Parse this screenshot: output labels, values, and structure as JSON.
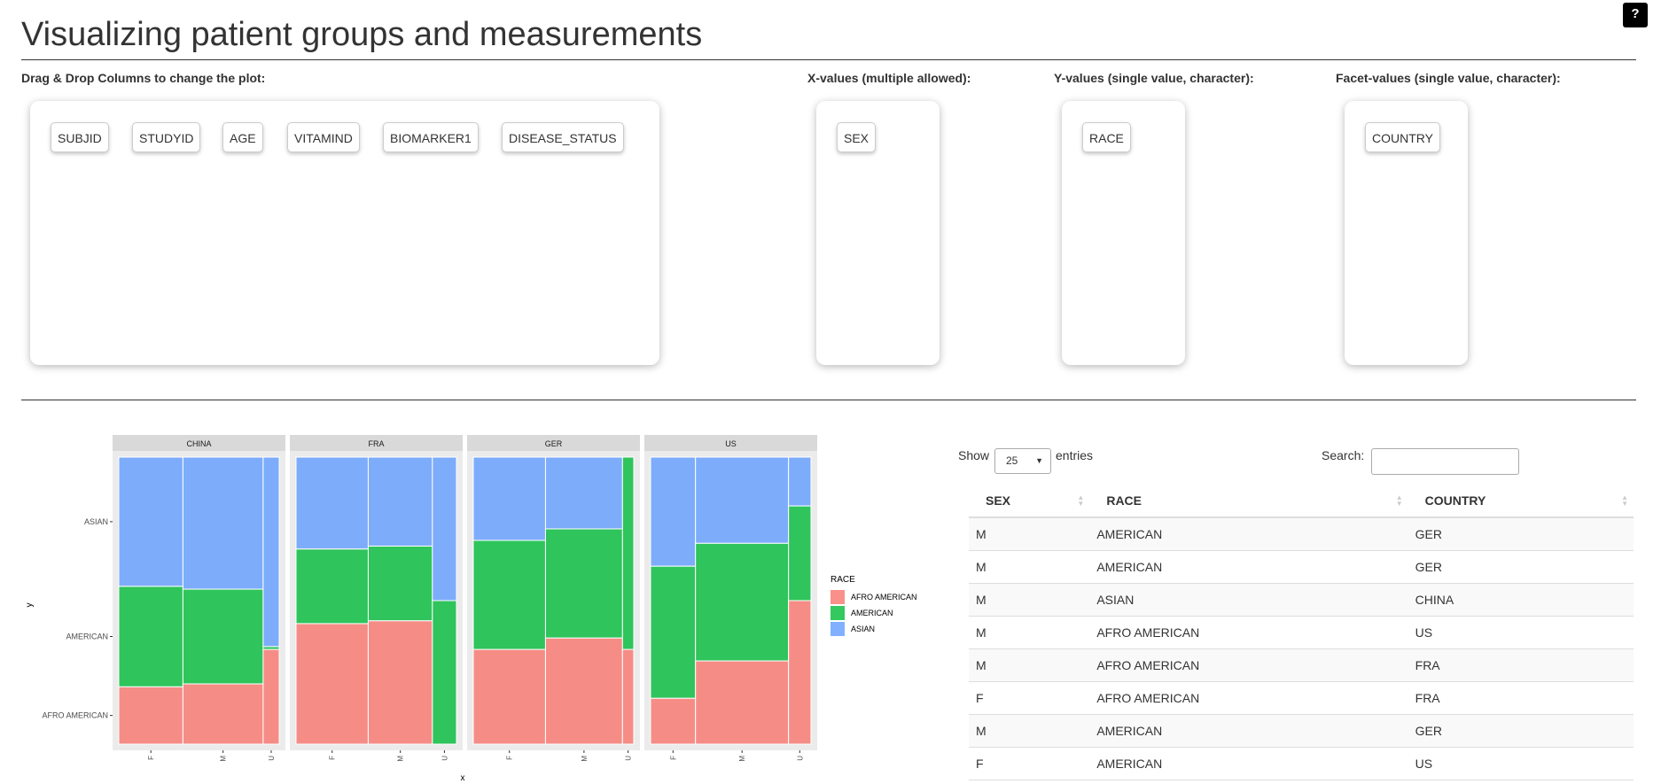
{
  "header": {
    "title": "Visualizing patient groups and measurements",
    "help_label": "?"
  },
  "dnd": {
    "source": {
      "label": "Drag & Drop Columns to change the plot:",
      "items": [
        "SUBJID",
        "STUDYID",
        "AGE",
        "VITAMIND",
        "BIOMARKER1",
        "DISEASE_STATUS"
      ]
    },
    "x": {
      "label": "X-values (multiple allowed):",
      "items": [
        "SEX"
      ]
    },
    "y": {
      "label": "Y-values (single value, character):",
      "items": [
        "RACE"
      ]
    },
    "facet": {
      "label": "Facet-values (single value, character):",
      "items": [
        "COUNTRY"
      ]
    }
  },
  "table": {
    "show_label": "Show",
    "entries_label": "entries",
    "length_value": "25",
    "search_label": "Search:",
    "search_value": "",
    "columns": [
      "SEX",
      "RACE",
      "COUNTRY"
    ],
    "rows": [
      [
        "M",
        "AMERICAN",
        "GER"
      ],
      [
        "M",
        "AMERICAN",
        "GER"
      ],
      [
        "M",
        "ASIAN",
        "CHINA"
      ],
      [
        "M",
        "AFRO AMERICAN",
        "US"
      ],
      [
        "M",
        "AFRO AMERICAN",
        "FRA"
      ],
      [
        "F",
        "AFRO AMERICAN",
        "FRA"
      ],
      [
        "M",
        "AMERICAN",
        "GER"
      ],
      [
        "F",
        "AMERICAN",
        "US"
      ]
    ]
  },
  "chart_data": {
    "type": "mosaic",
    "xlabel": "x",
    "ylabel": "y",
    "x_levels": [
      "F",
      "M",
      "U"
    ],
    "y_ticks": [
      "AFRO AMERICAN",
      "AMERICAN",
      "ASIAN"
    ],
    "legend": {
      "title": "RACE",
      "position": "right"
    },
    "series": [
      {
        "name": "AFRO AMERICAN",
        "color": "#F8766D"
      },
      {
        "name": "AMERICAN",
        "color": "#00BA38"
      },
      {
        "name": "ASIAN",
        "color": "#619CFF"
      }
    ],
    "facets": [
      {
        "name": "CHINA",
        "columns": [
          {
            "x": "F",
            "width": 0.4,
            "fractions": [
              0.2,
              0.35,
              0.45
            ]
          },
          {
            "x": "M",
            "width": 0.5,
            "fractions": [
              0.21,
              0.33,
              0.46
            ]
          },
          {
            "x": "U",
            "width": 0.1,
            "fractions": [
              0.33,
              0.01,
              0.66
            ]
          }
        ]
      },
      {
        "name": "FRA",
        "columns": [
          {
            "x": "F",
            "width": 0.45,
            "fractions": [
              0.42,
              0.26,
              0.32
            ]
          },
          {
            "x": "M",
            "width": 0.4,
            "fractions": [
              0.43,
              0.26,
              0.31
            ]
          },
          {
            "x": "U",
            "width": 0.15,
            "fractions": [
              0.0,
              0.5,
              0.5
            ]
          }
        ]
      },
      {
        "name": "GER",
        "columns": [
          {
            "x": "F",
            "width": 0.45,
            "fractions": [
              0.33,
              0.38,
              0.29
            ]
          },
          {
            "x": "M",
            "width": 0.48,
            "fractions": [
              0.37,
              0.38,
              0.25
            ]
          },
          {
            "x": "U",
            "width": 0.07,
            "fractions": [
              0.33,
              0.67,
              0.0
            ]
          }
        ]
      },
      {
        "name": "US",
        "columns": [
          {
            "x": "F",
            "width": 0.28,
            "fractions": [
              0.16,
              0.46,
              0.38
            ]
          },
          {
            "x": "M",
            "width": 0.58,
            "fractions": [
              0.29,
              0.41,
              0.3
            ]
          },
          {
            "x": "U",
            "width": 0.14,
            "fractions": [
              0.5,
              0.33,
              0.17
            ]
          }
        ]
      }
    ]
  }
}
